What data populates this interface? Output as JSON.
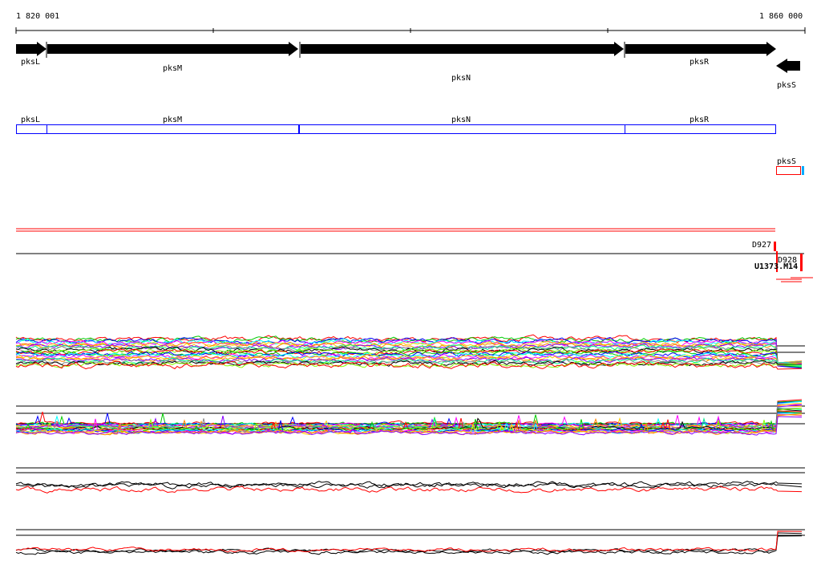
{
  "ruler": {
    "start_label": "1 820 001",
    "end_label": "1 860 000"
  },
  "genes": [
    {
      "name": "pksL",
      "strand": "+"
    },
    {
      "name": "pksM",
      "strand": "+"
    },
    {
      "name": "pksN",
      "strand": "+"
    },
    {
      "name": "pksR",
      "strand": "+"
    },
    {
      "name": "pksS",
      "strand": "-"
    }
  ],
  "regions": {
    "pksL": "pksL",
    "pksM": "pksM",
    "pksN": "pksN",
    "pksR": "pksR",
    "pksS": "pksS"
  },
  "features": {
    "d927": "D927",
    "d928": "D928",
    "u1373": "U1373.M14"
  },
  "colors": {
    "gene": "#000000",
    "region_box": "#0000ff",
    "marker": "#ff0000",
    "accent": "#00aaff"
  },
  "trace_palette": [
    "#ff0000",
    "#00cc00",
    "#0000ff",
    "#00ffff",
    "#ff00ff",
    "#ffcc00",
    "#ff8800",
    "#8800ff",
    "#00ff88",
    "#888888",
    "#000000",
    "#88ff00"
  ]
}
